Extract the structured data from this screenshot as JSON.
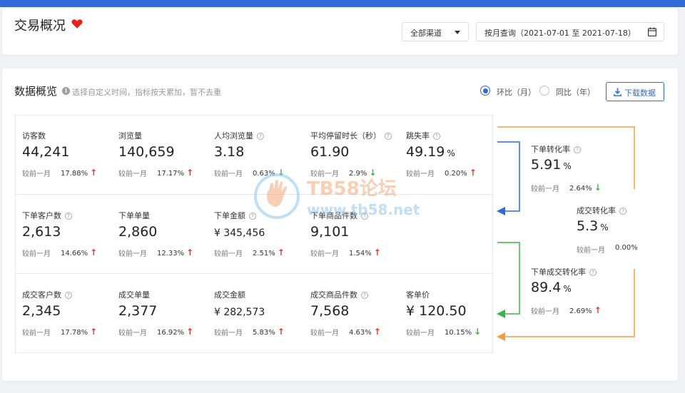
{
  "header": {
    "title": "交易概况",
    "channel_select": "全部渠道",
    "date_range": "按月查询（2021-07-01 至 2021-07-18）"
  },
  "overview": {
    "title": "数据概览",
    "hint": "选择自定义时间，指标按天累加，暂不去重",
    "compare_options": [
      "环比（月）",
      "同比（年）"
    ],
    "selected_compare": "环比（月）",
    "download_label": "下载数据",
    "compare_prefix": "较前一月"
  },
  "metrics": [
    [
      {
        "label": "访客数",
        "value": "44,241",
        "change": "17.88%",
        "trend": "up"
      },
      {
        "label": "浏览量",
        "value": "140,659",
        "change": "17.17%",
        "trend": "up"
      },
      {
        "label": "人均浏览量",
        "value": "3.18",
        "change": "0.63%",
        "trend": "down"
      },
      {
        "label": "平均停留时长（秒）",
        "value": "61.90",
        "change": "2.9%",
        "trend": "down"
      },
      {
        "label": "跳失率",
        "value": "49.19",
        "unit": "%",
        "change": "0.20%",
        "trend": "up"
      }
    ],
    [
      {
        "label": "下单客户数",
        "value": "2,613",
        "change": "14.66%",
        "trend": "up"
      },
      {
        "label": "下单单量",
        "value": "2,860",
        "change": "12.33%",
        "trend": "up"
      },
      {
        "label": "下单金额",
        "value": "¥ 345,456",
        "change": "2.51%",
        "trend": "up"
      },
      {
        "label": "下单商品件数",
        "value": "9,101",
        "change": "1.54%",
        "trend": "up"
      }
    ],
    [
      {
        "label": "成交客户数",
        "value": "2,345",
        "change": "17.78%",
        "trend": "up"
      },
      {
        "label": "成交单量",
        "value": "2,377",
        "change": "16.92%",
        "trend": "up"
      },
      {
        "label": "成交金额",
        "value": "¥ 282,573",
        "change": "5.83%",
        "trend": "up"
      },
      {
        "label": "成交商品件数",
        "value": "7,568",
        "change": "4.63%",
        "trend": "up"
      },
      {
        "label": "客单价",
        "value": "¥ 120.50",
        "change": "10.15%",
        "trend": "down"
      }
    ]
  ],
  "conversions": [
    {
      "label": "下单转化率",
      "value": "5.91",
      "unit": "%",
      "change": "2.64%",
      "trend": "down"
    },
    {
      "label": "成交转化率",
      "value": "5.3",
      "unit": "%",
      "change": "0.00%",
      "trend": "none"
    },
    {
      "label": "下单成交转化率",
      "value": "89.4",
      "unit": "%",
      "change": "2.69%",
      "trend": "up"
    }
  ],
  "watermark": {
    "title": "TB58论坛",
    "url": "www.tb58.net"
  },
  "colors": {
    "accent": "#2f6bd6",
    "up": "#e8382f",
    "down": "#3bb54a",
    "flow_orange": "#f0a040",
    "flow_blue": "#2f6bd6",
    "flow_green": "#3bb54a"
  }
}
